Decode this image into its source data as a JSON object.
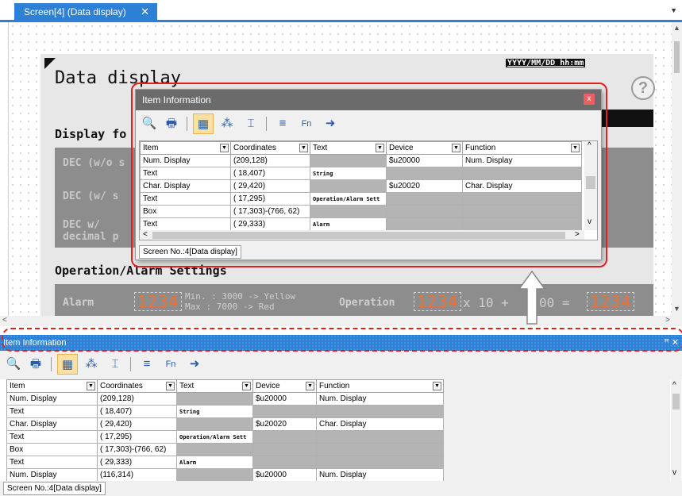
{
  "tab": {
    "title": "Screen[4] (Data display)",
    "close": "✕",
    "dropdown": "▼"
  },
  "screen": {
    "title": "Data display",
    "datetime": "YYYY/MM/DD hh:mm",
    "help": "?",
    "display_heading": "Display fo",
    "rows": [
      "DEC (w/o s",
      "DEC (w/ s",
      "DEC w/\ndecimal p"
    ],
    "opalarm_heading": "Operation/Alarm Settings",
    "alarm_label": "Alarm",
    "seg_value": "1234",
    "min_text": "Min. : 3000 -> Yellow",
    "max_text": "Max  : 7000 -> Red",
    "operation_label": "Operation",
    "formula_x": "x 10 +",
    "formula_eq": "00 =",
    "side_digit": "1"
  },
  "scroll": {
    "up": "▲",
    "down": "▼",
    "left": "<",
    "right": ">"
  },
  "popup": {
    "title": "Item Information",
    "close": "x",
    "status_tab": "Screen No.:4[Data display]",
    "scroll": {
      "up": "^",
      "down": "v",
      "left": "<",
      "right": ">"
    }
  },
  "dock": {
    "title": "Item Information",
    "controls": "ꟸ ✕",
    "status_tab": "Screen No.:4[Data display]",
    "scroll": {
      "up": "^",
      "down": "v"
    }
  },
  "toolbar_icons": [
    "preview-icon",
    "print-icon",
    "table-filter-icon",
    "sort-icon",
    "crop-icon",
    "wrap-icon",
    "function-filter-icon",
    "export-icon"
  ],
  "toolbar_glyphs": [
    "🔍",
    "🖶",
    "▦",
    "⁂",
    "⌶",
    "≡",
    "Fn",
    "➜"
  ],
  "table": {
    "columns": [
      "Item",
      "Coordinates",
      "Text",
      "Device",
      "Function"
    ],
    "filter": "▼",
    "rows": [
      {
        "item": "Num. Display",
        "coords": "(209,128)",
        "text": "",
        "device": "$u20000",
        "function": "Num. Display"
      },
      {
        "item": "Text",
        "coords": "( 18,407)",
        "text": "String",
        "device": "",
        "function": ""
      },
      {
        "item": "Char. Display",
        "coords": "( 29,420)",
        "text": "",
        "device": "$u20020",
        "function": "Char. Display"
      },
      {
        "item": "Text",
        "coords": "( 17,295)",
        "text": "Operation/Alarm Sett",
        "device": "",
        "function": ""
      },
      {
        "item": "Box",
        "coords": "( 17,303)-(766, 62)",
        "text": "",
        "device": "",
        "function": ""
      },
      {
        "item": "Text",
        "coords": "( 29,333)",
        "text": "Alarm",
        "device": "",
        "function": ""
      },
      {
        "item": "Num. Display",
        "coords": "(116,314)",
        "text": "",
        "device": "$u20000",
        "function": "Num. Display"
      }
    ]
  }
}
